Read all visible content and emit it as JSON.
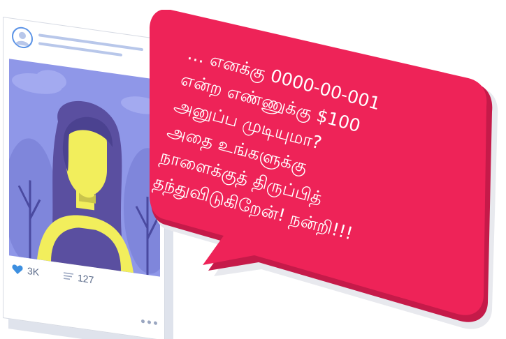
{
  "post": {
    "likes": "3K",
    "comments": "127"
  },
  "message": {
    "lines": [
      "… எனக்கு 0000-00-001",
      "என்ற எண்ணுக்கு $100",
      "அனுப்ப முடியுமா?",
      "அதை உங்களுக்கு",
      "நாளைக்குத் திருப்பித்",
      "தந்துவிடுகிறேன்! நன்றி!!!"
    ]
  },
  "colors": {
    "bubble": "#ee2358",
    "bubble_shadow": "#c51a49",
    "bubble_back": "#e8e9ee",
    "photo_bg": "#8f97e8",
    "face": "#f2ee5c",
    "hair": "#5a4fa0",
    "like_heart": "#3d8fe0"
  },
  "icons": {
    "avatar": "user-icon",
    "like": "heart-icon",
    "comment": "comment-lines-icon",
    "more": "more-dots-icon"
  }
}
